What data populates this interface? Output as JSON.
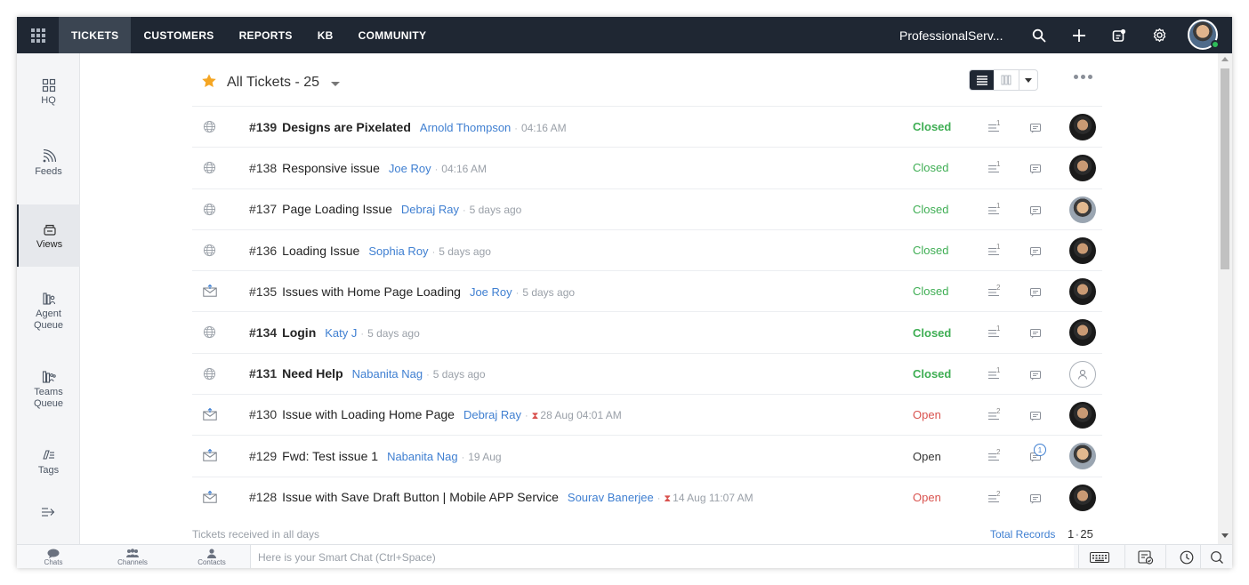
{
  "topnav": {
    "tabs": [
      {
        "label": "TICKETS"
      },
      {
        "label": "CUSTOMERS"
      },
      {
        "label": "REPORTS"
      },
      {
        "label": "KB"
      },
      {
        "label": "COMMUNITY"
      }
    ],
    "org_name": "ProfessionalServ..."
  },
  "leftnav": {
    "items": [
      {
        "label": "HQ"
      },
      {
        "label": "Feeds"
      },
      {
        "label": "Views"
      },
      {
        "label": "Agent Queue"
      },
      {
        "label": "Teams Queue"
      },
      {
        "label": "Tags"
      }
    ]
  },
  "header": {
    "view_title": "All Tickets - 25"
  },
  "tickets": [
    {
      "id": "#139",
      "subject": "Designs are Pixelated",
      "contact": "Arnold Thompson",
      "time": "04:16 AM",
      "status": "Closed",
      "threads": "1",
      "channel": "web",
      "bold": true,
      "agent": "dark",
      "overdue": false
    },
    {
      "id": "#138",
      "subject": "Responsive issue",
      "contact": "Joe Roy",
      "time": "04:16 AM",
      "status": "Closed",
      "threads": "1",
      "channel": "web",
      "bold": false,
      "agent": "dark",
      "overdue": false
    },
    {
      "id": "#137",
      "subject": "Page Loading Issue",
      "contact": "Debraj Ray",
      "time": "5 days ago",
      "status": "Closed",
      "threads": "1",
      "channel": "web",
      "bold": false,
      "agent": "light",
      "overdue": false
    },
    {
      "id": "#136",
      "subject": "Loading Issue",
      "contact": "Sophia Roy",
      "time": "5 days ago",
      "status": "Closed",
      "threads": "1",
      "channel": "web",
      "bold": false,
      "agent": "dark",
      "overdue": false
    },
    {
      "id": "#135",
      "subject": "Issues with Home Page Loading",
      "contact": "Joe Roy",
      "time": "5 days ago",
      "status": "Closed",
      "threads": "2",
      "channel": "email",
      "bold": false,
      "agent": "dark",
      "overdue": false
    },
    {
      "id": "#134",
      "subject": "Login",
      "contact": "Katy J",
      "time": "5 days ago",
      "status": "Closed",
      "threads": "1",
      "channel": "web",
      "bold": true,
      "agent": "dark",
      "overdue": false
    },
    {
      "id": "#131",
      "subject": "Need Help",
      "contact": "Nabanita Nag",
      "time": "5 days ago",
      "status": "Closed",
      "threads": "1",
      "channel": "web",
      "bold": true,
      "agent": "none",
      "overdue": false
    },
    {
      "id": "#130",
      "subject": "Issue with Loading Home Page",
      "contact": "Debraj Ray",
      "time": "28 Aug 04:01 AM",
      "status": "Open",
      "threads": "2",
      "channel": "email",
      "bold": false,
      "agent": "dark",
      "overdue": true
    },
    {
      "id": "#129",
      "subject": "Fwd: Test issue 1",
      "contact": "Nabanita Nag",
      "time": "19 Aug",
      "status": "Open",
      "threads": "2",
      "channel": "email",
      "bold": false,
      "agent": "light",
      "overdue": false,
      "comment_badge": "1"
    },
    {
      "id": "#128",
      "subject": "Issue with Save Draft Button | Mobile APP Service",
      "contact": "Sourav Banerjee",
      "time": "14 Aug 11:07 AM",
      "status": "Open",
      "threads": "2",
      "channel": "email",
      "bold": false,
      "agent": "dark",
      "overdue": true
    }
  ],
  "footer": {
    "filter_note": "Tickets received in all days",
    "total_label": "Total Records",
    "page": "1",
    "total": "25"
  },
  "bottombar": {
    "items": [
      {
        "label": "Chats"
      },
      {
        "label": "Channels"
      },
      {
        "label": "Contacts"
      }
    ],
    "smart_chat_placeholder": "Here is your Smart Chat (Ctrl+Space)"
  },
  "colors": {
    "topbar": "#1f2733",
    "closed": "#3fae54",
    "open_red": "#d9534f",
    "link": "#3f7fd1",
    "star": "#f5a623"
  }
}
